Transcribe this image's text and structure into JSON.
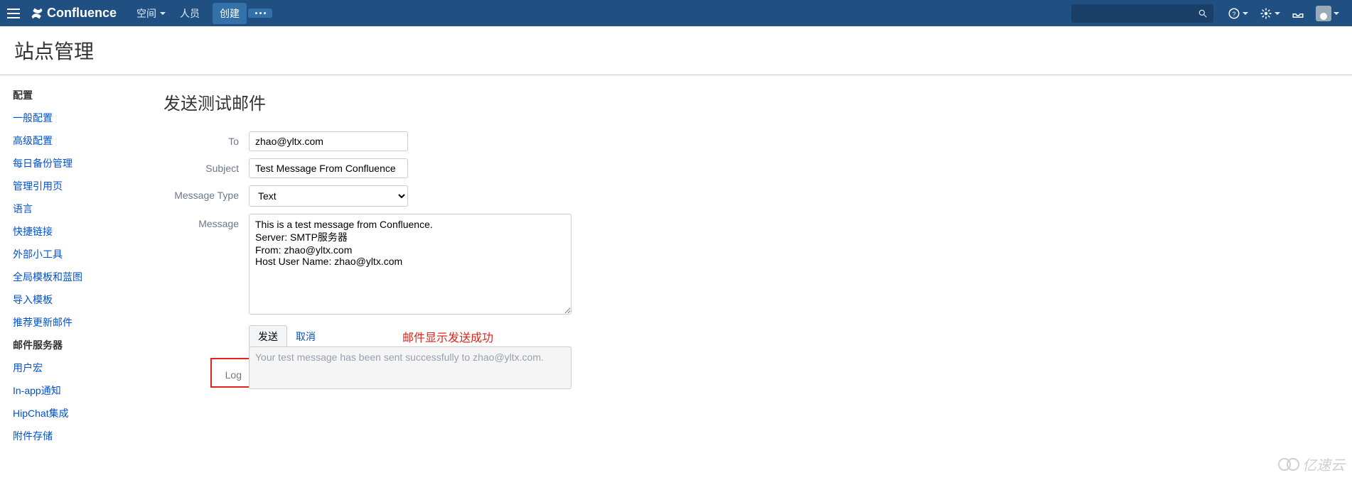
{
  "topbar": {
    "brand": "Confluence",
    "spaces": "空间",
    "people": "人员",
    "create": "创建"
  },
  "page": {
    "title": "站点管理"
  },
  "sidebar": {
    "heading": "配置",
    "items": [
      {
        "label": "一般配置",
        "active": false
      },
      {
        "label": "高级配置",
        "active": false
      },
      {
        "label": "每日备份管理",
        "active": false
      },
      {
        "label": "管理引用页",
        "active": false
      },
      {
        "label": "语言",
        "active": false
      },
      {
        "label": "快捷链接",
        "active": false
      },
      {
        "label": "外部小工具",
        "active": false
      },
      {
        "label": "全局模板和蓝图",
        "active": false
      },
      {
        "label": "导入模板",
        "active": false
      },
      {
        "label": "推荐更新邮件",
        "active": false
      },
      {
        "label": "邮件服务器",
        "active": true
      },
      {
        "label": "用户宏",
        "active": false
      },
      {
        "label": "In-app通知",
        "active": false
      },
      {
        "label": "HipChat集成",
        "active": false
      },
      {
        "label": "附件存储",
        "active": false
      }
    ]
  },
  "form": {
    "heading": "发送测试邮件",
    "to": {
      "label": "To",
      "value": "zhao@yltx.com"
    },
    "subject": {
      "label": "Subject",
      "value": "Test Message From Confluence"
    },
    "type": {
      "label": "Message Type",
      "value": "Text"
    },
    "message": {
      "label": "Message",
      "value": "This is a test message from Confluence.\nServer: SMTP服务器\nFrom: zhao@yltx.com\nHost User Name: zhao@yltx.com"
    },
    "send": "发送",
    "cancel": "取消",
    "note": "邮件显示发送成功",
    "log": {
      "label": "Log",
      "value": "Your test message has been sent successfully to zhao@yltx.com."
    }
  },
  "watermark": "亿速云"
}
